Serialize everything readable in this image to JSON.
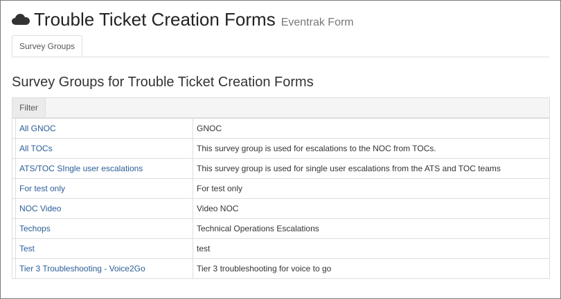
{
  "header": {
    "icon": "cloud-icon",
    "title": "Trouble Ticket Creation Forms",
    "subtitle": "Eventrak Form"
  },
  "tabs": [
    {
      "label": "Survey Groups",
      "active": true
    }
  ],
  "section": {
    "title": "Survey Groups for Trouble Ticket Creation Forms",
    "filter_label": "Filter"
  },
  "rows": [
    {
      "name": "All GNOC",
      "description": "GNOC"
    },
    {
      "name": "All TOCs",
      "description": "This survey group is used for escalations to the NOC from TOCs."
    },
    {
      "name": "ATS/TOC SIngle user escalations",
      "description": "This survey group is used for single user escalations from the ATS and TOC teams"
    },
    {
      "name": "For test only",
      "description": "For test only"
    },
    {
      "name": "NOC Video",
      "description": "Video NOC"
    },
    {
      "name": "Techops",
      "description": "Technical Operations Escalations"
    },
    {
      "name": "Test",
      "description": "test"
    },
    {
      "name": "Tier 3 Troubleshooting - Voice2Go",
      "description": "Tier 3 troubleshooting for voice to go"
    }
  ],
  "colors": {
    "link": "#2a5d96",
    "border": "#dddddd",
    "filter_bg": "#f5f5f5"
  }
}
